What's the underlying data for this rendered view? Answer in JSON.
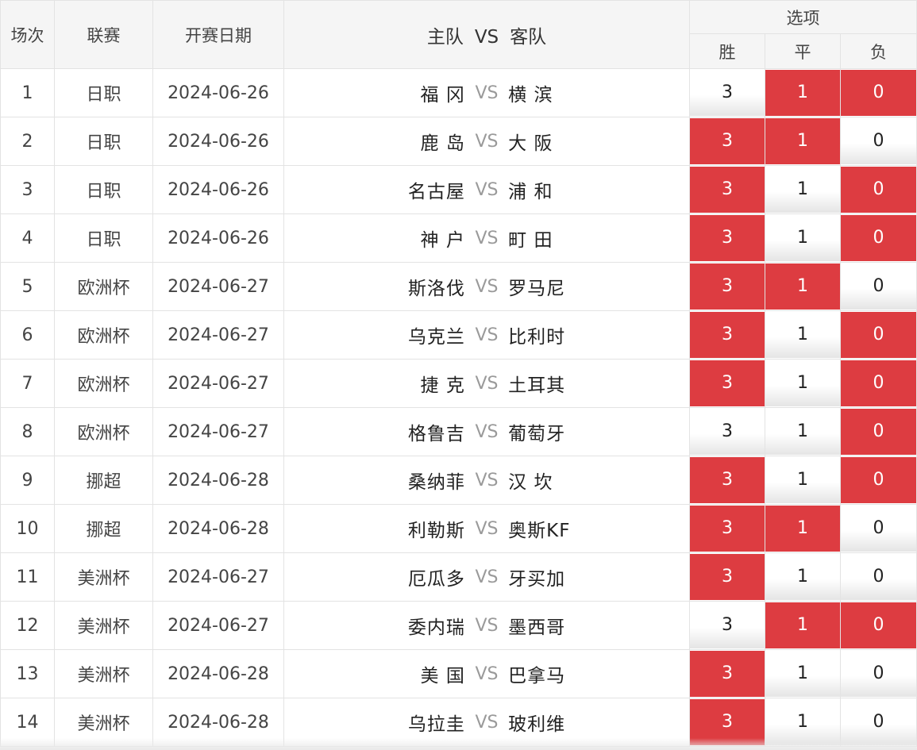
{
  "header": {
    "index": "场次",
    "league": "联赛",
    "date": "开赛日期",
    "home": "主队",
    "vs": "VS",
    "away": "客队",
    "options": "选项",
    "win": "胜",
    "draw": "平",
    "loss": "负"
  },
  "colors": {
    "selected": "#dd3c41",
    "unselected": "#f5f5f5"
  },
  "rows": [
    {
      "index": "1",
      "league": "日职",
      "date": "2024-06-26",
      "home": "福 冈",
      "vs": "VS",
      "away": "横 滨",
      "win": "3",
      "draw": "1",
      "loss": "0",
      "win_selected": false,
      "draw_selected": true,
      "loss_selected": true
    },
    {
      "index": "2",
      "league": "日职",
      "date": "2024-06-26",
      "home": "鹿 岛",
      "vs": "VS",
      "away": "大 阪",
      "win": "3",
      "draw": "1",
      "loss": "0",
      "win_selected": true,
      "draw_selected": true,
      "loss_selected": false
    },
    {
      "index": "3",
      "league": "日职",
      "date": "2024-06-26",
      "home": "名古屋",
      "vs": "VS",
      "away": "浦 和",
      "win": "3",
      "draw": "1",
      "loss": "0",
      "win_selected": true,
      "draw_selected": false,
      "loss_selected": true
    },
    {
      "index": "4",
      "league": "日职",
      "date": "2024-06-26",
      "home": "神 户",
      "vs": "VS",
      "away": "町 田",
      "win": "3",
      "draw": "1",
      "loss": "0",
      "win_selected": true,
      "draw_selected": false,
      "loss_selected": true
    },
    {
      "index": "5",
      "league": "欧洲杯",
      "date": "2024-06-27",
      "home": "斯洛伐",
      "vs": "VS",
      "away": "罗马尼",
      "win": "3",
      "draw": "1",
      "loss": "0",
      "win_selected": true,
      "draw_selected": true,
      "loss_selected": false
    },
    {
      "index": "6",
      "league": "欧洲杯",
      "date": "2024-06-27",
      "home": "乌克兰",
      "vs": "VS",
      "away": "比利时",
      "win": "3",
      "draw": "1",
      "loss": "0",
      "win_selected": true,
      "draw_selected": false,
      "loss_selected": true
    },
    {
      "index": "7",
      "league": "欧洲杯",
      "date": "2024-06-27",
      "home": "捷 克",
      "vs": "VS",
      "away": "土耳其",
      "win": "3",
      "draw": "1",
      "loss": "0",
      "win_selected": true,
      "draw_selected": false,
      "loss_selected": true
    },
    {
      "index": "8",
      "league": "欧洲杯",
      "date": "2024-06-27",
      "home": "格鲁吉",
      "vs": "VS",
      "away": "葡萄牙",
      "win": "3",
      "draw": "1",
      "loss": "0",
      "win_selected": false,
      "draw_selected": false,
      "loss_selected": true
    },
    {
      "index": "9",
      "league": "挪超",
      "date": "2024-06-28",
      "home": "桑纳菲",
      "vs": "VS",
      "away": "汉 坎",
      "win": "3",
      "draw": "1",
      "loss": "0",
      "win_selected": true,
      "draw_selected": false,
      "loss_selected": true
    },
    {
      "index": "10",
      "league": "挪超",
      "date": "2024-06-28",
      "home": "利勒斯",
      "vs": "VS",
      "away": "奥斯KF",
      "win": "3",
      "draw": "1",
      "loss": "0",
      "win_selected": true,
      "draw_selected": true,
      "loss_selected": false
    },
    {
      "index": "11",
      "league": "美洲杯",
      "date": "2024-06-27",
      "home": "厄瓜多",
      "vs": "VS",
      "away": "牙买加",
      "win": "3",
      "draw": "1",
      "loss": "0",
      "win_selected": true,
      "draw_selected": false,
      "loss_selected": false
    },
    {
      "index": "12",
      "league": "美洲杯",
      "date": "2024-06-27",
      "home": "委内瑞",
      "vs": "VS",
      "away": "墨西哥",
      "win": "3",
      "draw": "1",
      "loss": "0",
      "win_selected": false,
      "draw_selected": true,
      "loss_selected": true
    },
    {
      "index": "13",
      "league": "美洲杯",
      "date": "2024-06-28",
      "home": "美 国",
      "vs": "VS",
      "away": "巴拿马",
      "win": "3",
      "draw": "1",
      "loss": "0",
      "win_selected": true,
      "draw_selected": false,
      "loss_selected": false
    },
    {
      "index": "14",
      "league": "美洲杯",
      "date": "2024-06-28",
      "home": "乌拉圭",
      "vs": "VS",
      "away": "玻利维",
      "win": "3",
      "draw": "1",
      "loss": "0",
      "win_selected": true,
      "draw_selected": false,
      "loss_selected": false
    }
  ]
}
